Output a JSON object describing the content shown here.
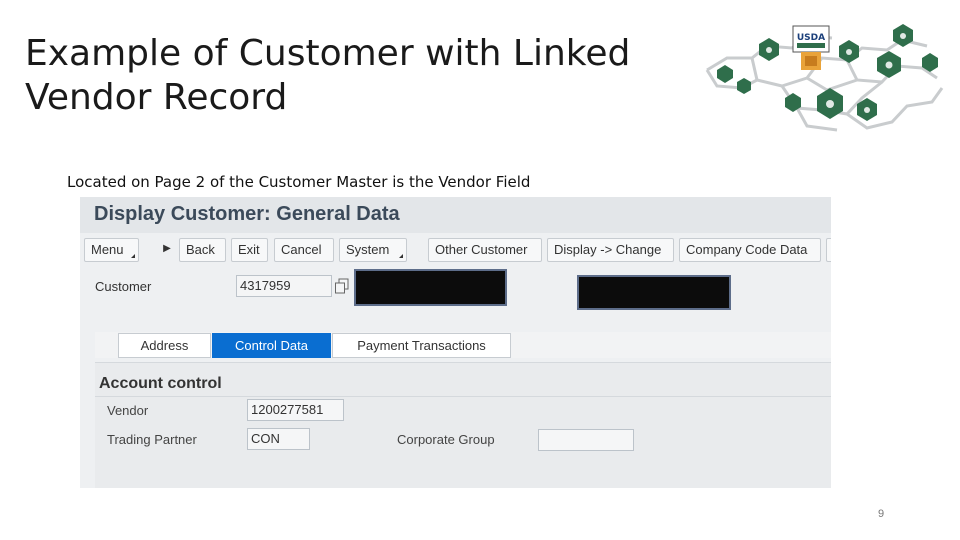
{
  "slide": {
    "title": "Example of Customer with Linked Vendor Record",
    "subtitle": "Located on Page 2 of the Customer Master is the Vendor Field",
    "page_number": "9",
    "logo_text": "USDA"
  },
  "sap": {
    "window_title": "Display Customer: General Data",
    "toolbar": [
      {
        "name": "menu-button",
        "label": "Menu",
        "dropdown": true
      },
      {
        "name": "back-button",
        "label": "Back",
        "dropdown": false
      },
      {
        "name": "exit-button",
        "label": "Exit",
        "dropdown": false
      },
      {
        "name": "cancel-button",
        "label": "Cancel",
        "dropdown": false
      },
      {
        "name": "system-button",
        "label": "System",
        "dropdown": true
      },
      {
        "name": "other-customer-button",
        "label": "Other Customer",
        "dropdown": false
      },
      {
        "name": "display-change-button",
        "label": "Display -> Change",
        "dropdown": false
      },
      {
        "name": "company-code-data-button",
        "label": "Company Code Data",
        "dropdown": false
      }
    ],
    "customer": {
      "label": "Customer",
      "value": "4317959"
    },
    "tabs": [
      {
        "label": "Address",
        "active": false
      },
      {
        "label": "Control Data",
        "active": true
      },
      {
        "label": "Payment Transactions",
        "active": false
      }
    ],
    "account_control": {
      "title": "Account control",
      "vendor_label": "Vendor",
      "vendor_value": "1200277581",
      "trading_partner_label": "Trading Partner",
      "trading_partner_value": "CON",
      "corporate_group_label": "Corporate Group",
      "corporate_group_value": ""
    }
  },
  "colors": {
    "active_tab": "#0a6ed1",
    "logo_green": "#2f6e4b",
    "redaction": "#0c0c0c"
  }
}
